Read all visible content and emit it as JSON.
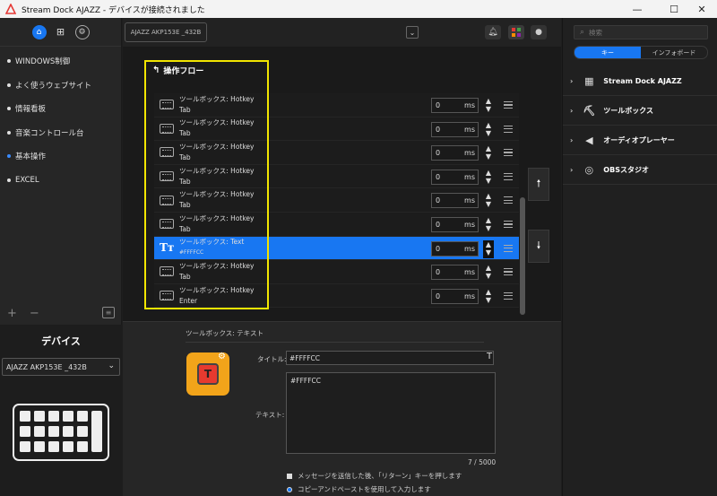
{
  "window": {
    "title": "Stream Dock AJAZZ - デバイスが接続されました"
  },
  "sidebar": {
    "items": [
      {
        "label": "WINDOWS制御"
      },
      {
        "label": "よく使うウェブサイト"
      },
      {
        "label": "情報看板"
      },
      {
        "label": "音楽コントロール台"
      },
      {
        "label": "基本操作"
      },
      {
        "label": "EXCEL"
      }
    ],
    "add": "+",
    "remove": "−"
  },
  "device": {
    "title": "デバイス",
    "selected": "AJAZZ AKP153E _432B",
    "tab_label": "AJAZZ AKP153E _432B"
  },
  "flow": {
    "header": "操作フロー",
    "rows": [
      {
        "label": "ツールボックス: Hotkey",
        "sub": "Tab",
        "ms": "0",
        "unit": "ms"
      },
      {
        "label": "ツールボックス: Hotkey",
        "sub": "Tab",
        "ms": "0",
        "unit": "ms"
      },
      {
        "label": "ツールボックス: Hotkey",
        "sub": "Tab",
        "ms": "0",
        "unit": "ms"
      },
      {
        "label": "ツールボックス: Hotkey",
        "sub": "Tab",
        "ms": "0",
        "unit": "ms"
      },
      {
        "label": "ツールボックス: Hotkey",
        "sub": "Tab",
        "ms": "0",
        "unit": "ms"
      },
      {
        "label": "ツールボックス: Hotkey",
        "sub": "Tab",
        "ms": "0",
        "unit": "ms"
      },
      {
        "label": "ツールボックス: Text",
        "sub": "#FFFFCC",
        "ms": "0",
        "unit": "ms"
      },
      {
        "label": "ツールボックス: Hotkey",
        "sub": "Tab",
        "ms": "0",
        "unit": "ms"
      },
      {
        "label": "ツールボックス: Hotkey",
        "sub": "Enter",
        "ms": "0",
        "unit": "ms"
      }
    ]
  },
  "props": {
    "section_title": "ツールボックス: テキスト",
    "title_label": "タイトル:",
    "title_value": "#FFFFCC",
    "text_label": "テキスト:",
    "text_value": "#FFFFCC",
    "counter": "7 / 5000",
    "option1": "メッセージを送信した後、「リターン」キーを押します",
    "option2": "コピーアンドペーストを使用して入力します"
  },
  "right": {
    "search_placeholder": "検索",
    "tab_keys": "キー",
    "tab_info": "インフォボード",
    "categories": [
      {
        "label": "Stream Dock AJAZZ"
      },
      {
        "label": "ツールボックス"
      },
      {
        "label": "オーディオプレーヤー"
      },
      {
        "label": "OBSスタジオ"
      }
    ]
  },
  "colors": {
    "accent": "#1877f2",
    "highlight": "#f2e500",
    "key_bg": "#f2a41a"
  }
}
